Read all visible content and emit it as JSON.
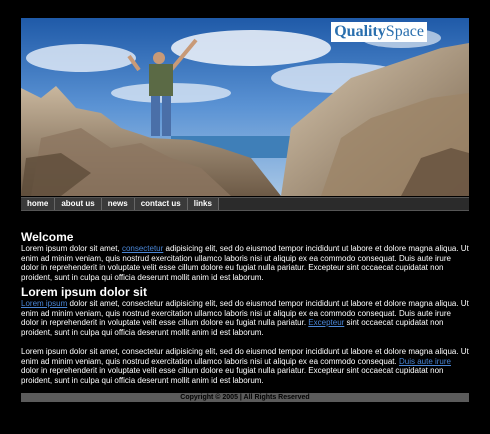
{
  "logo": {
    "part1": "Quality",
    "part2": "Space"
  },
  "nav": {
    "items": [
      {
        "label": "home"
      },
      {
        "label": "about us"
      },
      {
        "label": "news"
      },
      {
        "label": "contact us"
      },
      {
        "label": "links"
      }
    ]
  },
  "section1": {
    "title": "Welcome",
    "p1_a": "Lorem ipsum dolor sit amet, ",
    "p1_link": "consectetur",
    "p1_b": " adipisicing elit, sed do eiusmod tempor incididunt ut labore et dolore magna aliqua. Ut enim ad minim veniam, quis nostrud exercitation ullamco laboris nisi ut aliquip ex ea commodo consequat. Duis aute irure dolor in reprehenderit in voluptate velit esse cillum dolore eu fugiat nulla pariatur. Excepteur sint occaecat cupidatat non proident, sunt in culpa qui officia deserunt mollit anim id est laborum."
  },
  "section2": {
    "title": "Lorem ipsum dolor sit",
    "p1_link": "Lorem ipsum",
    "p1_a": " dolor sit amet, consectetur adipisicing elit, sed do eiusmod tempor incididunt ut labore et dolore magna aliqua. Ut enim ad minim veniam, quis nostrud exercitation ullamco laboris nisi ut aliquip ex ea commodo consequat. Duis aute irure dolor in reprehenderit in voluptate velit esse cillum dolore eu fugiat nulla pariatur. ",
    "p1_link2": "Excepteur",
    "p1_b": " sint occaecat cupidatat non proident, sunt in culpa qui officia deserunt mollit anim id est laborum.",
    "p2_a": "Lorem ipsum dolor sit amet, consectetur adipisicing elit, sed do eiusmod tempor incididunt ut labore et dolore magna aliqua. Ut enim ad minim veniam, quis nostrud exercitation ullamco laboris nisi ut aliquip ex ea commodo consequat. ",
    "p2_link": "Duis aute irure",
    "p2_b": " dolor in reprehenderit in voluptate velit esse cillum dolore eu fugiat nulla pariatur. Excepteur sint occaecat cupidatat non proident, sunt in culpa qui officia deserunt mollit anim id est laborum."
  },
  "footer": {
    "text": "Copyright © 2005 | All Rights Reserved"
  },
  "colors": {
    "link": "#4a86d6",
    "nav_bg": "#3a3a3a",
    "footer_bg": "#5b5b5b",
    "page_bg": "#000000"
  }
}
